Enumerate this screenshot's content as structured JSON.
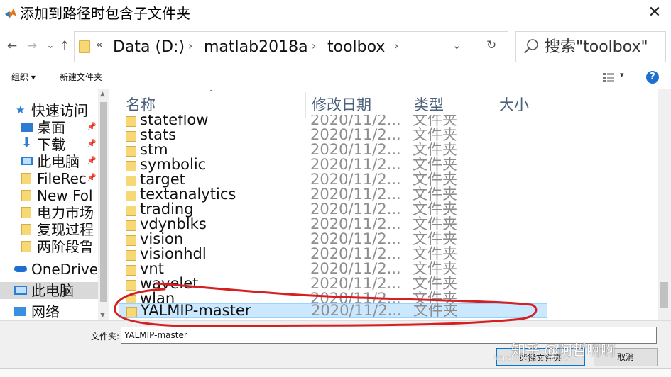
{
  "window": {
    "title": "添加到路径时包含子文件夹",
    "close_glyph": "✕"
  },
  "nav": {
    "back": "←",
    "forward": "→",
    "recent": "⌄",
    "up": "↑",
    "address": {
      "overflow": "«",
      "crumbs": [
        "Data (D:)",
        "matlab2018a",
        "toolbox"
      ],
      "separator": "›",
      "dropdown": "⌄",
      "refresh": "↻"
    },
    "search_placeholder": "搜索\"toolbox\""
  },
  "toolbar": {
    "organize": "组织 ▾",
    "new_folder": "新建文件夹",
    "view_dropdown": "▾",
    "help": "?"
  },
  "sidebar": {
    "items": [
      {
        "label": "快速访问",
        "icon": "star-icon"
      },
      {
        "label": "桌面",
        "icon": "desktop-icon",
        "pinned": true
      },
      {
        "label": "下载",
        "icon": "download-icon",
        "pinned": true
      },
      {
        "label": "此电脑",
        "icon": "computer-icon",
        "pinned": true
      },
      {
        "label": "FileRec",
        "icon": "folder-icon",
        "pinned": true
      },
      {
        "label": "New Fol",
        "icon": "folder-icon"
      },
      {
        "label": "电力市场",
        "icon": "folder-icon"
      },
      {
        "label": "复现过程",
        "icon": "folder-icon"
      },
      {
        "label": "两阶段鲁",
        "icon": "folder-icon"
      },
      {
        "label": "OneDrive",
        "icon": "onedrive-icon"
      },
      {
        "label": "此电脑",
        "icon": "computer-icon",
        "selected": true
      },
      {
        "label": "网络",
        "icon": "network-icon"
      }
    ],
    "pin_glyph": "📌"
  },
  "columns": {
    "name": "名称",
    "modified": "修改日期",
    "type": "类型",
    "size": "大小"
  },
  "files": [
    {
      "name": "stateflow",
      "date": "2020/11/2...",
      "type": "文件夹"
    },
    {
      "name": "stats",
      "date": "2020/11/2...",
      "type": "文件夹"
    },
    {
      "name": "stm",
      "date": "2020/11/2...",
      "type": "文件夹"
    },
    {
      "name": "symbolic",
      "date": "2020/11/2...",
      "type": "文件夹"
    },
    {
      "name": "target",
      "date": "2020/11/2...",
      "type": "文件夹"
    },
    {
      "name": "textanalytics",
      "date": "2020/11/2...",
      "type": "文件夹"
    },
    {
      "name": "trading",
      "date": "2020/11/2...",
      "type": "文件夹"
    },
    {
      "name": "vdynblks",
      "date": "2020/11/2...",
      "type": "文件夹"
    },
    {
      "name": "vision",
      "date": "2020/11/2...",
      "type": "文件夹"
    },
    {
      "name": "visionhdl",
      "date": "2020/11/2...",
      "type": "文件夹"
    },
    {
      "name": "vnt",
      "date": "2020/11/2...",
      "type": "文件夹"
    },
    {
      "name": "wavelet",
      "date": "2020/11/2...",
      "type": "文件夹"
    },
    {
      "name": "wlan",
      "date": "2020/11/2...",
      "type": "文件夹"
    },
    {
      "name": "YALMIP-master",
      "date": "2020/11/2...",
      "type": "文件夹",
      "selected": true
    }
  ],
  "bottom": {
    "folder_label": "文件夹:",
    "folder_value": "YALMIP-master",
    "select_button": "选择文件夹",
    "cancel_button": "取消"
  },
  "watermark": {
    "main": "知乎 @阿哲啊啊",
    "sub": "https://blog.csdn.net/..."
  },
  "colors": {
    "selection_bg": "#cce8ff",
    "header_text": "#4c607a",
    "annotation_stroke": "#d42020",
    "folder_yellow": "#f8d775"
  }
}
